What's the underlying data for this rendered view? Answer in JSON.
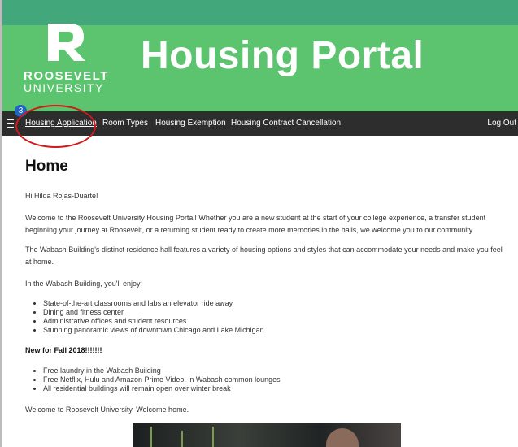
{
  "header": {
    "logo_line1": "ROOSEVELT",
    "logo_line2": "UNIVERSITY",
    "portal_title": "Housing Portal"
  },
  "nav": {
    "badge_count": "3",
    "items": [
      {
        "label": "Housing Application",
        "active": true
      },
      {
        "label": "Room Types"
      },
      {
        "label": "Housing Exemption"
      },
      {
        "label": "Housing Contract Cancellation"
      }
    ],
    "logout_label": "Log Out"
  },
  "main": {
    "title": "Home",
    "greeting": "Hi Hilda Rojas-Duarte!",
    "para1": "Welcome to the Roosevelt University Housing Portal! Whether you are a new student at the start of your college experience, a transfer student beginning your journey at Roosevelt, or a returning student ready to create more memories in the halls, we welcome you to our community.",
    "para2": "The Wabash Building's distinct residence hall features a variety of housing options and styles that can accommodate your needs and make you feel at home.",
    "para3": "In the Wabash Building, you'll enjoy:",
    "list1": [
      "State-of-the-art classrooms and labs an elevator ride away",
      "Dining and fitness center",
      "Administrative offices and student resources",
      "Stunning panoramic views of downtown Chicago and Lake Michigan"
    ],
    "new_heading": "New for Fall 2018!!!!!!!",
    "list2": [
      "Free laundry in the Wabash Building",
      "Free Netflix, Hulu and Amazon Prime Video, in Wabash common lounges",
      "All residential buildings will remain open over winter break"
    ],
    "closing": "Welcome to Roosevelt University. Welcome home."
  },
  "colors": {
    "header_green": "#5cc36e",
    "top_strip": "#43a77c",
    "navbar": "#2d2d2d",
    "annotation_red": "#d01a1a"
  }
}
